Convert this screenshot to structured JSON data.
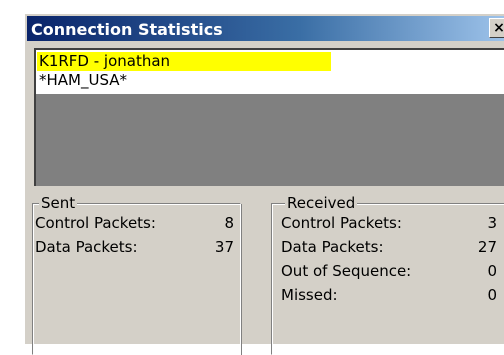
{
  "window": {
    "title": "Connection Statistics",
    "close_glyph": "×"
  },
  "connections": [
    {
      "label": "K1RFD - jonathan",
      "selected": true
    },
    {
      "label": "*HAM_USA*",
      "selected": false
    }
  ],
  "sent": {
    "legend": "Sent",
    "rows": [
      {
        "label": "Control Packets:",
        "value": "8"
      },
      {
        "label": "Data Packets:",
        "value": "37"
      }
    ]
  },
  "received": {
    "legend": "Received",
    "rows": [
      {
        "label": "Control Packets:",
        "value": "3"
      },
      {
        "label": "Data Packets:",
        "value": "27"
      },
      {
        "label": "Out of Sequence:",
        "value": "0"
      },
      {
        "label": "Missed:",
        "value": "0"
      }
    ]
  },
  "colors": {
    "selection": "#ffff00",
    "dialog_face": "#d4d0c8",
    "title_start": "#0a246a",
    "title_end": "#a6caf0"
  }
}
